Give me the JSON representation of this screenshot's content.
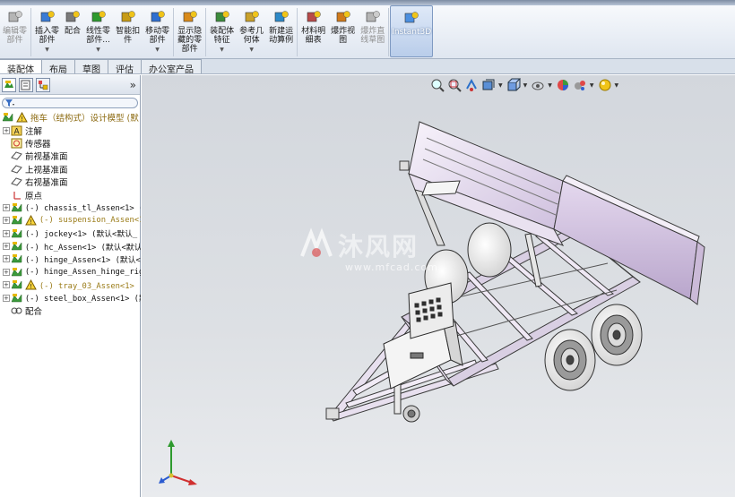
{
  "ribbon": {
    "buttons": [
      {
        "label": "编辑零\n部件",
        "disabled": true
      },
      {
        "label": "插入零\n部件",
        "arrow": true
      },
      {
        "label": "配合"
      },
      {
        "label": "线性零\n部件...",
        "arrow": true
      },
      {
        "label": "智能扣\n件"
      },
      {
        "label": "移动零\n部件",
        "arrow": true
      },
      {
        "label": "显示隐\n藏的零\n部件"
      },
      {
        "label": "装配体\n特征",
        "arrow": true
      },
      {
        "label": "参考几\n何体",
        "arrow": true
      },
      {
        "label": "新建运\n动算例"
      },
      {
        "label": "材料明\n细表"
      },
      {
        "label": "爆炸视\n图"
      },
      {
        "label": "爆炸直\n线草图",
        "disabled": true
      },
      {
        "label": "Instant3D",
        "active": true
      }
    ]
  },
  "tabs": [
    {
      "label": "装配体",
      "active": true
    },
    {
      "label": "布局"
    },
    {
      "label": "草图"
    },
    {
      "label": "评估"
    },
    {
      "label": "办公室产品"
    }
  ],
  "tree": {
    "root": "拖车（结构式）设计模型 (默",
    "items": [
      {
        "label": "注解",
        "type": "annotation",
        "expand": true,
        "cjk": true
      },
      {
        "label": "传感器",
        "type": "sensor",
        "expand": false,
        "cjk": true
      },
      {
        "label": "前视基准面",
        "type": "plane",
        "expand": false,
        "cjk": true
      },
      {
        "label": "上视基准面",
        "type": "plane",
        "expand": false,
        "cjk": true
      },
      {
        "label": "右视基准面",
        "type": "plane",
        "expand": false,
        "cjk": true
      },
      {
        "label": "原点",
        "type": "origin",
        "expand": false,
        "cjk": true
      },
      {
        "label": "(-) chassis_tl_Assen<1> (默",
        "type": "asm",
        "expand": true
      },
      {
        "label": "(-) suspension_Assen<1>",
        "type": "asm-warn",
        "expand": true,
        "warn": true
      },
      {
        "label": "(-) jockey<1> (默认<默认_",
        "type": "asm",
        "expand": true
      },
      {
        "label": "(-) hc_Assen<1> (默认<默认",
        "type": "asm",
        "expand": true
      },
      {
        "label": "(-) hinge_Assen<1> (默认<",
        "type": "asm",
        "expand": true
      },
      {
        "label": "(-) hinge_Assen_hinge_rig",
        "type": "asm",
        "expand": true
      },
      {
        "label": "(-) tray_03_Assen<1> (默",
        "type": "asm-warn",
        "expand": true,
        "warn": true
      },
      {
        "label": "(-) steel_box_Assen<1> (默",
        "type": "asm",
        "expand": true
      },
      {
        "label": "配合",
        "type": "mates",
        "expand": false,
        "cjk": true
      }
    ]
  },
  "watermark": {
    "text": "沐风网",
    "url": "www.mfcad.com"
  },
  "colors": {
    "tray": "#d6c6e2",
    "frame": "#c9bcd6",
    "wheel": "#f5f5f5"
  }
}
